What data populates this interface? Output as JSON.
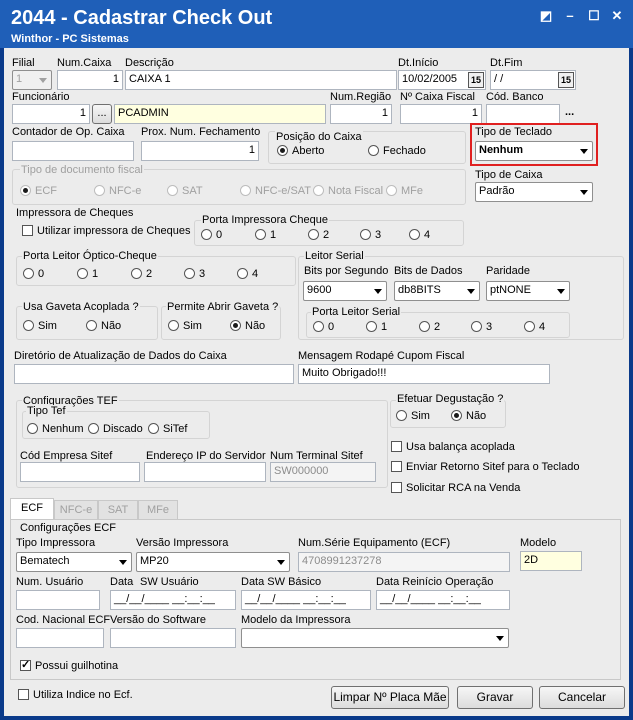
{
  "window": {
    "title": "2044 - Cadastrar Check Out",
    "subtitle": "Winthor - PC Sistemas",
    "controls": [
      "◩",
      "–",
      "☐",
      "✕"
    ]
  },
  "row1": {
    "filial_label": "Filial",
    "filial_value": "1",
    "numcaixa_label": "Num.Caixa",
    "numcaixa_value": "1",
    "descricao_label": "Descrição",
    "descricao_value": "CAIXA 1",
    "dtinicio_label": "Dt.Início",
    "dtinicio_value": "10/02/2005",
    "dtfim_label": "Dt.Fim",
    "dtfim_value": " / /",
    "cal_glyph": "15"
  },
  "row2": {
    "funcionario_label": "Funcionário",
    "funcionario_code": "1",
    "lookup_btn": "...",
    "funcionario_name": "PCADMIN",
    "numregiao_label": "Num.Região",
    "numregiao_value": "1",
    "nocaixafiscal_label": "Nº Caixa Fiscal",
    "nocaixafiscal_value": "1",
    "codbanco_label": "Cód. Banco",
    "codbanco_btn": "..."
  },
  "row3": {
    "contador_label": "Contador de Op. Caixa",
    "proxnum_label": "Prox. Num. Fechamento",
    "proxnum_value": "1",
    "posicao_label": "Posição do Caixa",
    "posicao_aberto": "Aberto",
    "posicao_fechado": "Fechado",
    "tipoteclado_label": "Tipo de Teclado",
    "tipoteclado_value": "Nenhum"
  },
  "tipodoc": {
    "label": "Tipo de documento fiscal",
    "options": [
      "ECF",
      "NFC-e",
      "SAT",
      "NFC-e/SAT",
      "Nota Fiscal",
      "MFe"
    ]
  },
  "tipocaixa": {
    "label": "Tipo de Caixa",
    "value": "Padrão"
  },
  "cheques": {
    "label": "Impressora de Cheques",
    "check_label": "Utilizar impressora de Cheques",
    "porta_label": "Porta Impressora Cheque",
    "portas": [
      "0",
      "1",
      "2",
      "3",
      "4"
    ]
  },
  "leitor": {
    "label": "Porta Leitor Óptico-Cheque",
    "portas": [
      "0",
      "1",
      "2",
      "3",
      "4"
    ]
  },
  "serial": {
    "label": "Leitor Serial",
    "bits_label": "Bits por Segundo",
    "bits_value": "9600",
    "dados_label": "Bits de Dados",
    "dados_value": "db8BITS",
    "paridade_label": "Paridade",
    "paridade_value": "ptNONE",
    "porta_label": "Porta Leitor Serial",
    "portas": [
      "0",
      "1",
      "2",
      "3",
      "4"
    ]
  },
  "gaveta": {
    "label": "Usa Gaveta Acoplada ?",
    "sim": "Sim",
    "nao": "Não",
    "abrir_label": "Permite Abrir Gaveta ?"
  },
  "diretorio": {
    "label": "Diretório de Atualização de Dados do Caixa",
    "value": ""
  },
  "rodape": {
    "label": "Mensagem Rodapé Cupom Fiscal",
    "value": "Muito Obrigado!!!"
  },
  "tef": {
    "label": "Configurações TEF",
    "tipo_label": "Tipo Tef",
    "nenhum": "Nenhum",
    "discado": "Discado",
    "sitef": "SiTef",
    "empresa_label": "Cód Empresa Sitef",
    "ip_label": "Endereço IP do Servidor",
    "terminal_label": "Num Terminal Sitef",
    "terminal_value": "SW000000"
  },
  "degustacao": {
    "label": "Efetuar Degustação ?",
    "sim": "Sim",
    "nao": "Não"
  },
  "checks": {
    "balanca": "Usa balança acoplada",
    "retorno": "Enviar Retorno Sitef para o Teclado",
    "rca": "Solicitar RCA na Venda"
  },
  "tabs": [
    "ECF",
    "NFC-e",
    "SAT",
    "MFe"
  ],
  "ecf": {
    "title": "Configurações ECF",
    "tipo_label": "Tipo Impressora",
    "tipo_value": "Bematech",
    "versao_label": "Versão Impressora",
    "versao_value": "MP20",
    "serie_label": "Num.Série Equipamento (ECF)",
    "serie_value": "4708991237278",
    "modelo_label": "Modelo",
    "modelo_value": "2D",
    "usuario_label": "Num. Usuário",
    "data_label": "Data",
    "swusuario_label": "SW Usuário",
    "dataswbasico_label": "Data SW Básico",
    "datareinicio_label": "Data Reinício Operação",
    "datetime_mask": "__/__/____ __:__:__",
    "codnac_label": "Cod. Nacional ECF",
    "versaosw_label": "Versão do Software",
    "modeloimp_label": "Modelo da Impressora",
    "guilhotina_label": "Possui guilhotina"
  },
  "footer": {
    "indice_label": "Utiliza Indice no Ecf.",
    "limpar": "Limpar Nº Placa Mãe",
    "gravar": "Gravar",
    "cancelar": "Cancelar"
  }
}
